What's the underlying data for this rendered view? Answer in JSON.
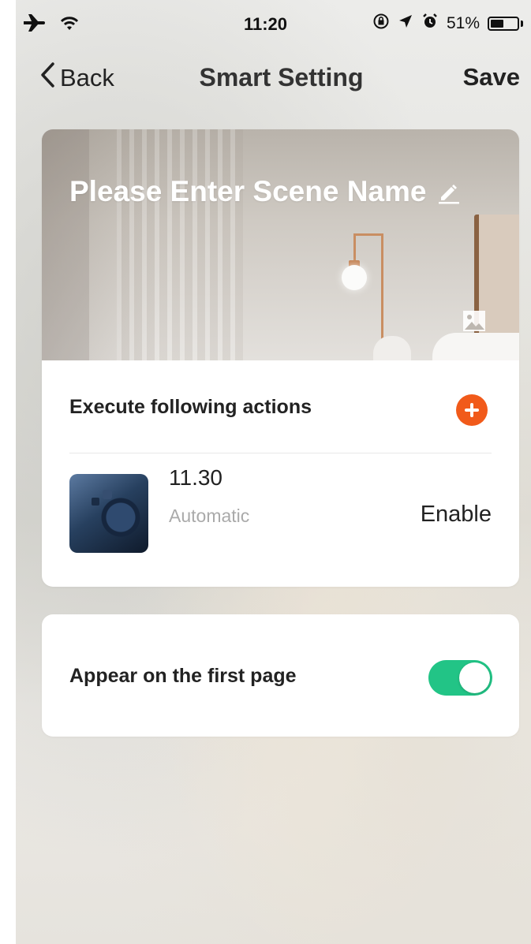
{
  "status_bar": {
    "time": "11:20",
    "battery_text": "51%",
    "battery_level": 0.51
  },
  "nav": {
    "back_label": "Back",
    "title": "Smart Setting",
    "save_label": "Save"
  },
  "scene": {
    "name_placeholder": "Please Enter Scene Name"
  },
  "actions": {
    "section_title": "Execute following actions",
    "items": [
      {
        "name": "11.30",
        "type": "Automatic",
        "status": "Enable"
      }
    ]
  },
  "settings": {
    "first_page_label": "Appear on the first page",
    "first_page_enabled": true
  },
  "colors": {
    "accent_orange": "#f15a1a",
    "toggle_on": "#22c486"
  }
}
